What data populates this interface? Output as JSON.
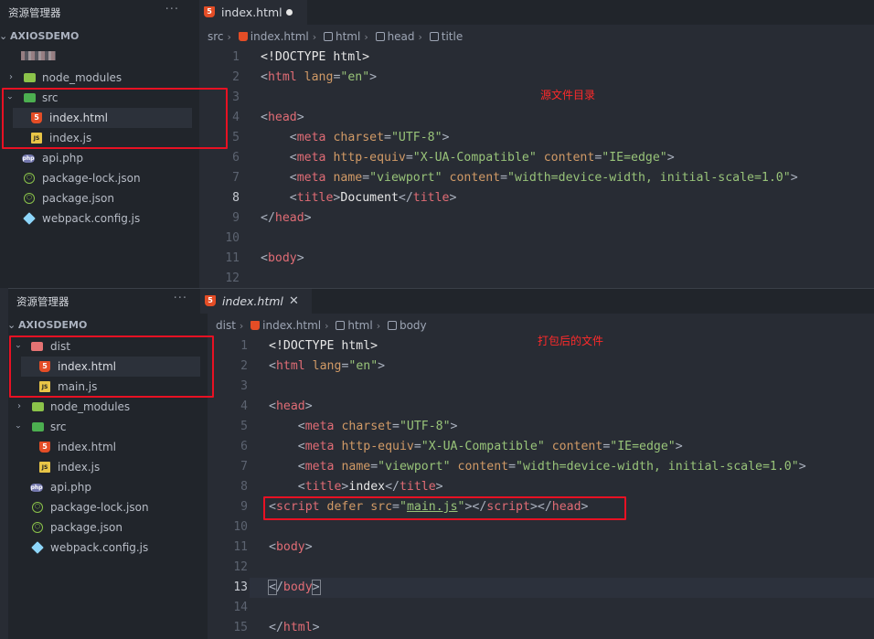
{
  "explorer": {
    "title": "资源管理器",
    "more": "···",
    "project": "AXIOSDEMO"
  },
  "top": {
    "tree": [
      {
        "label": "node_modules",
        "icon": "node-modules-folder-icon"
      },
      {
        "label": "src",
        "icon": "src-folder-icon"
      },
      {
        "label": "index.html",
        "icon": "html-file-icon"
      },
      {
        "label": "index.js",
        "icon": "js-file-icon"
      },
      {
        "label": "api.php",
        "icon": "php-file-icon"
      },
      {
        "label": "package-lock.json",
        "icon": "json-file-icon"
      },
      {
        "label": "package.json",
        "icon": "npm-file-icon"
      },
      {
        "label": "webpack.config.js",
        "icon": "webpack-file-icon"
      }
    ],
    "tab": "index.html",
    "breadcrumb": [
      "src",
      "index.html",
      "html",
      "head",
      "title"
    ],
    "note": "源文件目录",
    "line_numbers": [
      "1",
      "2",
      "3",
      "4",
      "5",
      "6",
      "7",
      "8",
      "9",
      "10",
      "11",
      "12"
    ],
    "current_line": "8"
  },
  "bottom": {
    "tree": [
      {
        "label": "dist",
        "icon": "dist-folder-icon"
      },
      {
        "label": "index.html",
        "icon": "html-file-icon"
      },
      {
        "label": "main.js",
        "icon": "js-file-icon"
      },
      {
        "label": "node_modules",
        "icon": "node-modules-folder-icon"
      },
      {
        "label": "src",
        "icon": "src-folder-icon"
      },
      {
        "label": "index.html",
        "icon": "html-file-icon"
      },
      {
        "label": "index.js",
        "icon": "js-file-icon"
      },
      {
        "label": "api.php",
        "icon": "php-file-icon"
      },
      {
        "label": "package-lock.json",
        "icon": "json-file-icon"
      },
      {
        "label": "package.json",
        "icon": "npm-file-icon"
      },
      {
        "label": "webpack.config.js",
        "icon": "webpack-file-icon"
      }
    ],
    "tab": "index.html",
    "tab_close": "✕",
    "breadcrumb": [
      "dist",
      "index.html",
      "html",
      "body"
    ],
    "note": "打包后的文件",
    "line_numbers": [
      "1",
      "2",
      "3",
      "4",
      "5",
      "6",
      "7",
      "8",
      "9",
      "10",
      "11",
      "12",
      "13",
      "14",
      "15"
    ],
    "current_line": "13"
  },
  "code": {
    "doctype": "<!DOCTYPE html>",
    "html_open": "html",
    "lang_attr": "lang",
    "lang_val": "\"en\"",
    "head": "head",
    "meta": "meta",
    "charset_attr": "charset",
    "charset_val": "\"UTF-8\"",
    "httpequiv_attr": "http-equiv",
    "httpequiv_val": "\"X-UA-Compatible\"",
    "content_attr": "content",
    "ie_val": "\"IE=edge\"",
    "name_attr": "name",
    "viewport_val": "\"viewport\"",
    "viewport_content": "\"width=device-width, initial-scale=1.0\"",
    "title": "title",
    "title_top": "Document",
    "title_bottom": "index",
    "script": "script",
    "defer": "defer",
    "src_attr": "src",
    "src_val": "main.js",
    "body": "body"
  },
  "colors": {
    "tag": "#e06c75",
    "attr": "#d19a66",
    "string": "#98c379",
    "annotation": "#e81123"
  }
}
